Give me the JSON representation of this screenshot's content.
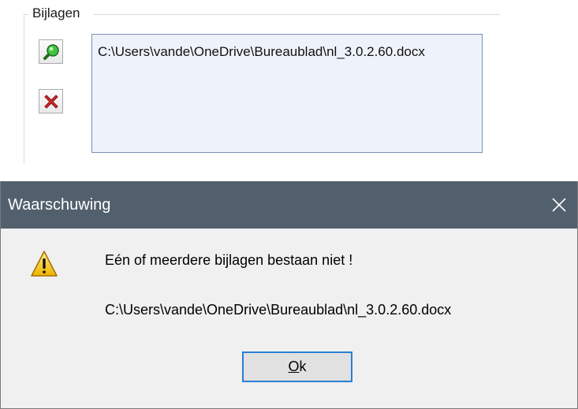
{
  "attachments_group": {
    "label": "Bijlagen",
    "add_icon": "magnifier-add-icon",
    "remove_icon": "red-x-icon",
    "items": [
      "C:\\Users\\vande\\OneDrive\\Bureaublad\\nl_3.0.2.60.docx"
    ]
  },
  "dialog": {
    "title": "Waarschuwing",
    "close_icon": "close-x-icon",
    "icon": "warning-triangle-icon",
    "message": "Eén of meerdere bijlagen bestaan niet !",
    "path": "C:\\Users\\vande\\OneDrive\\Bureaublad\\nl_3.0.2.60.docx",
    "ok_label_accel": "O",
    "ok_label_rest": "k"
  },
  "colors": {
    "titlebar": "#52606e",
    "list_background": "#eef3fb",
    "ok_border": "#2a7fd4",
    "dialog_background": "#f0f0f0"
  }
}
